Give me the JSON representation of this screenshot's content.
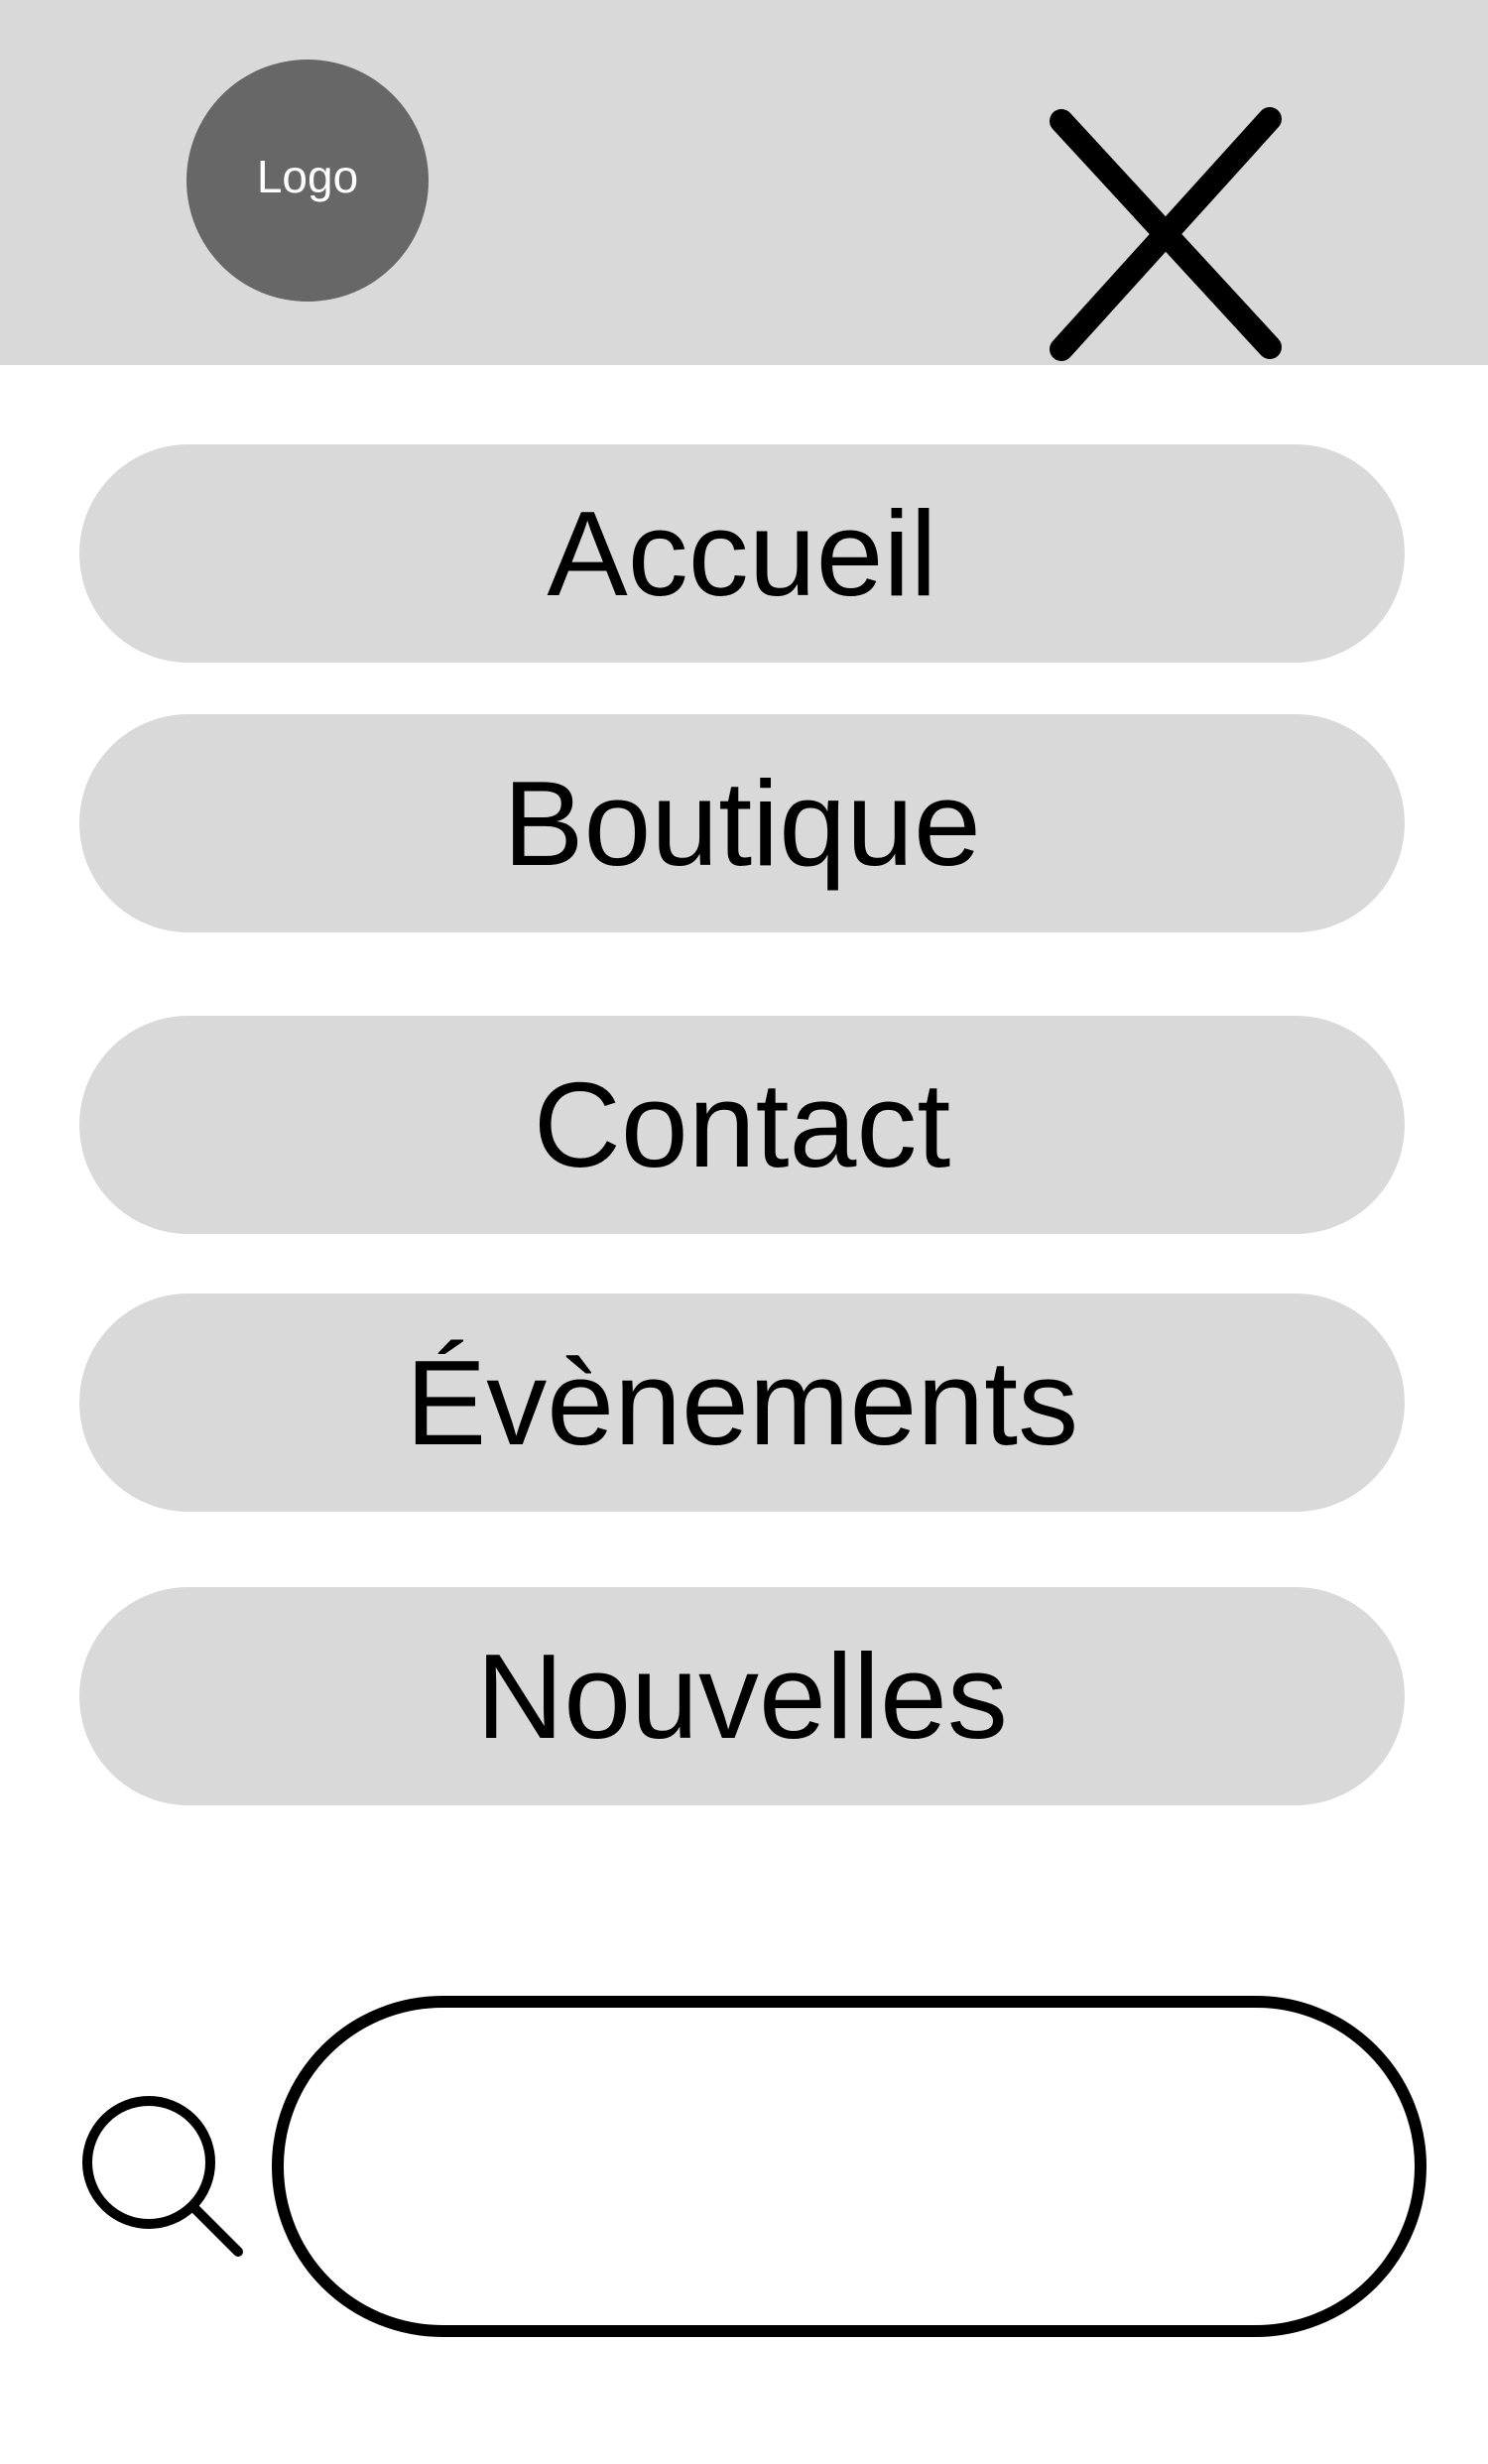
{
  "header": {
    "logo_text": "Logo",
    "close_icon": "close-icon",
    "background": "#d9d9d9",
    "logo_color": "#676767"
  },
  "nav": {
    "items": [
      {
        "label": "Accueil"
      },
      {
        "label": "Boutique"
      },
      {
        "label": "Contact"
      },
      {
        "label": "Évènements"
      },
      {
        "label": "Nouvelles"
      }
    ]
  },
  "search": {
    "icon": "search-icon",
    "value": "",
    "placeholder": ""
  }
}
